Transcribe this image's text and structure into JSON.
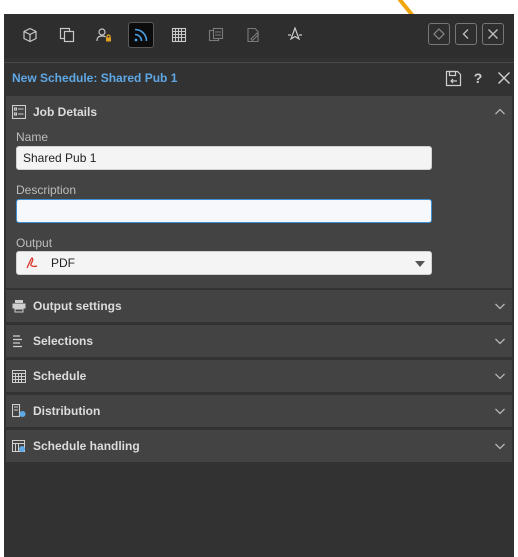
{
  "panel": {
    "title": "New Schedule: Shared Pub 1"
  },
  "toolbar": {
    "icons": [
      "cube-icon",
      "copy-icon",
      "user-lock-icon",
      "rss-icon",
      "grid-icon",
      "database-copy-icon",
      "document-edit-icon",
      "compass-icon"
    ],
    "active_icon": "rss-icon"
  },
  "job_details": {
    "heading": "Job Details",
    "name_label": "Name",
    "name_value": "Shared Pub 1",
    "description_label": "Description",
    "description_value": "",
    "output_label": "Output",
    "output_value": "PDF"
  },
  "sections": [
    {
      "label": "Output settings",
      "icon": "printer-icon"
    },
    {
      "label": "Selections",
      "icon": "list-icon"
    },
    {
      "label": "Schedule",
      "icon": "calendar-icon"
    },
    {
      "label": "Distribution",
      "icon": "distribution-icon"
    },
    {
      "label": "Schedule handling",
      "icon": "calendar-gear-icon"
    }
  ],
  "colors": {
    "title_accent": "#5ea8e6",
    "panel_bg": "#323232",
    "section_bg": "#434343",
    "callout_arrow": "#f0a50a"
  }
}
